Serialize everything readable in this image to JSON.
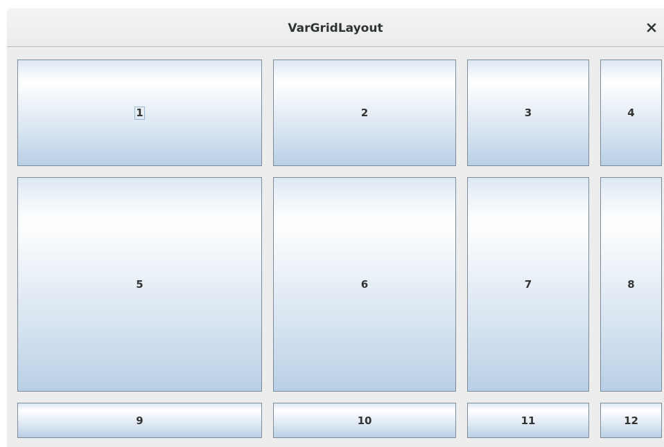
{
  "window": {
    "title": "VarGridLayout",
    "close_icon": "close-icon"
  },
  "buttons": [
    {
      "label": "1",
      "focused": true
    },
    {
      "label": "2"
    },
    {
      "label": "3"
    },
    {
      "label": "4"
    },
    {
      "label": "5"
    },
    {
      "label": "6"
    },
    {
      "label": "7"
    },
    {
      "label": "8"
    },
    {
      "label": "9"
    },
    {
      "label": "10"
    },
    {
      "label": "11"
    },
    {
      "label": "12"
    }
  ]
}
